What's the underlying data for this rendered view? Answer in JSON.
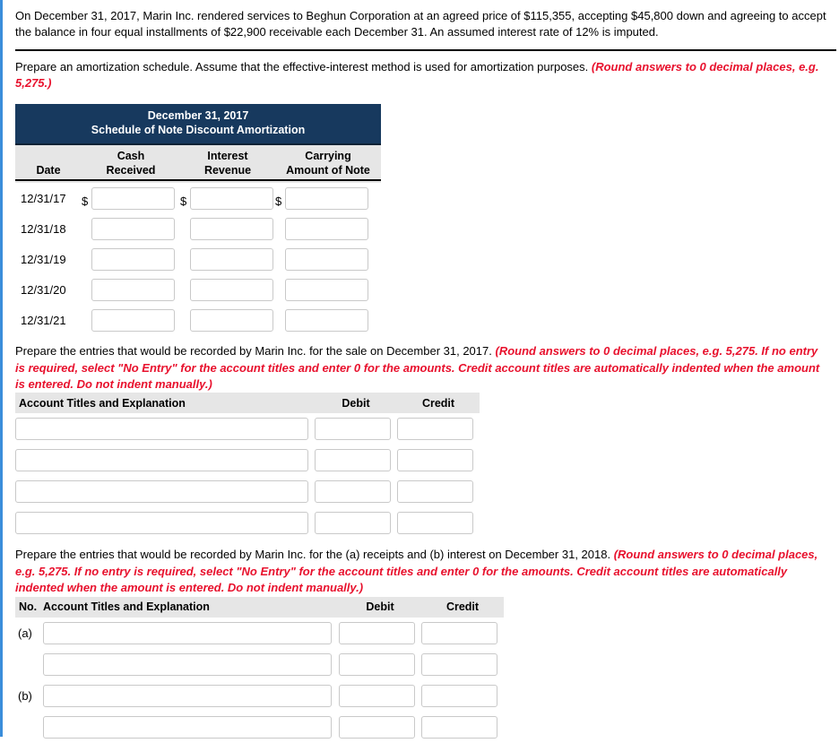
{
  "problem": {
    "statement": "On December 31, 2017, Marin Inc. rendered services to Beghun Corporation at an agreed price of $115,355, accepting $45,800 down and agreeing to accept the balance in four equal installments of $22,900 receivable each December 31. An assumed interest rate of 12% is imputed."
  },
  "part_a": {
    "instruction": "Prepare an amortization schedule. Assume that the effective-interest method is used for amortization purposes. ",
    "hint": "(Round answers to 0 decimal places, e.g. 5,275.)",
    "table": {
      "title_line1": "December 31, 2017",
      "title_line2": "Schedule of Note Discount Amortization",
      "columns": [
        {
          "line1": "",
          "line2": "Date"
        },
        {
          "line1": "Cash",
          "line2": "Received"
        },
        {
          "line1": "Interest",
          "line2": "Revenue"
        },
        {
          "line1": "Carrying",
          "line2": "Amount of Note"
        }
      ],
      "currency_symbol": "$",
      "rows": [
        {
          "date": "12/31/17",
          "cash": "",
          "interest": "",
          "carrying": "",
          "show_currency": true
        },
        {
          "date": "12/31/18",
          "cash": "",
          "interest": "",
          "carrying": "",
          "show_currency": false
        },
        {
          "date": "12/31/19",
          "cash": "",
          "interest": "",
          "carrying": "",
          "show_currency": false
        },
        {
          "date": "12/31/20",
          "cash": "",
          "interest": "",
          "carrying": "",
          "show_currency": false
        },
        {
          "date": "12/31/21",
          "cash": "",
          "interest": "",
          "carrying": "",
          "show_currency": false
        }
      ]
    }
  },
  "part_b": {
    "instruction": "Prepare the entries that would be recorded by Marin Inc. for the sale on December 31, 2017. ",
    "hint": "(Round answers to 0 decimal places, e.g. 5,275. If no entry is required, select \"No Entry\" for the account titles and enter 0 for the amounts. Credit account titles are automatically indented when the amount is entered. Do not indent manually.)",
    "table": {
      "headers": {
        "account": "Account Titles and Explanation",
        "debit": "Debit",
        "credit": "Credit"
      },
      "rows": [
        {
          "account": "",
          "debit": "",
          "credit": ""
        },
        {
          "account": "",
          "debit": "",
          "credit": ""
        },
        {
          "account": "",
          "debit": "",
          "credit": ""
        },
        {
          "account": "",
          "debit": "",
          "credit": ""
        }
      ]
    }
  },
  "part_c": {
    "instruction": "Prepare the entries that would be recorded by Marin Inc. for the (a) receipts and (b) interest on December 31, 2018. ",
    "hint": "(Round answers to 0 decimal places, e.g. 5,275. If no entry is required, select \"No Entry\" for the account titles and enter 0 for the amounts. Credit account titles are automatically indented when the amount is entered. Do not indent manually.)",
    "table": {
      "headers": {
        "no": "No.",
        "account": "Account Titles and Explanation",
        "debit": "Debit",
        "credit": "Credit"
      },
      "rows": [
        {
          "no": "(a)",
          "account": "",
          "debit": "",
          "credit": ""
        },
        {
          "no": "",
          "account": "",
          "debit": "",
          "credit": ""
        },
        {
          "no": "(b)",
          "account": "",
          "debit": "",
          "credit": ""
        },
        {
          "no": "",
          "account": "",
          "debit": "",
          "credit": ""
        }
      ]
    }
  },
  "colors": {
    "table_header_navy": "#17395e",
    "column_header_gray": "#e6e6e6",
    "hint_red": "#e8112d",
    "left_rail_blue": "#3a8ddb",
    "input_border": "#c9c9c9"
  }
}
